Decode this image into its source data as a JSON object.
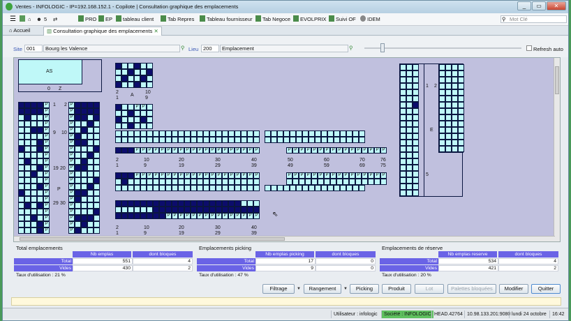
{
  "window": {
    "title": "Ventes - INFOLOGIC - IP=192.168.152.1 - Copilote | Consultation graphique des emplacements",
    "controls": [
      "_",
      "▭",
      "✕"
    ]
  },
  "toolbar": {
    "menu_count": "5",
    "items": [
      "PRO",
      "EP",
      "tableau client",
      "Tab Repres",
      "Tableau fournisseur",
      "Tab Negoce",
      "EVOLPRIX",
      "Suivi OF",
      "IDEM"
    ],
    "search_placeholder": "Mot Clé"
  },
  "tabs": {
    "home": "Accueil",
    "active": "Consultation graphique des emplacements",
    "close": "✕"
  },
  "filters": {
    "site_label": "Site",
    "site_code": "001",
    "site_name": "Bourg les Valence",
    "lieu_label": "Lieu",
    "lieu_code": "200",
    "lieu_name": "Emplacement",
    "refresh_label": "Refresh auto",
    "slider_percent": 10
  },
  "map": {
    "zone_as": "AS",
    "zone_as_0": "0",
    "zone_as_z": "Z",
    "zone_a": "A",
    "zone_a_2": "2",
    "zone_a_1": "1",
    "zone_a_10": "10",
    "zone_a_9": "9",
    "left_labels": [
      "1",
      "2",
      "9",
      "10",
      "19",
      "20",
      "P",
      "29",
      "30"
    ],
    "row_top": [
      "2",
      "1",
      "10",
      "9",
      "20",
      "19",
      "30",
      "29",
      "40",
      "39",
      "50",
      "49",
      "60",
      "59",
      "70",
      "69",
      "76",
      "75"
    ],
    "row_bottom": [
      "2",
      "1",
      "10",
      "9",
      "20",
      "19",
      "30",
      "29",
      "40",
      "39"
    ],
    "right_labels": [
      "1",
      "2",
      "E",
      "5"
    ]
  },
  "summary": [
    {
      "title": "Total emplacements",
      "col1": "Nb emplas",
      "col2": "dont bloques",
      "rows": [
        {
          "label": "Total",
          "v1": "551",
          "v2": "4"
        },
        {
          "label": "Vides",
          "v1": "430",
          "v2": "2"
        }
      ],
      "taux": "Taux d'utilisation : 21 %"
    },
    {
      "title": "Emplacements picking",
      "col1": "Nb emplas picking",
      "col2": "dont bloques",
      "rows": [
        {
          "label": "Total",
          "v1": "17",
          "v2": "0"
        },
        {
          "label": "Vides",
          "v1": "9",
          "v2": "0"
        }
      ],
      "taux": "Taux d'utilisation : 47 %"
    },
    {
      "title": "Emplacements de réserve",
      "col1": "Nb emplas reserve",
      "col2": "dont bloques",
      "rows": [
        {
          "label": "Total",
          "v1": "534",
          "v2": "4"
        },
        {
          "label": "Vides",
          "v1": "421",
          "v2": "2"
        }
      ],
      "taux": "Taux d'utilisation : 20 %"
    }
  ],
  "buttons": {
    "filtrage": "Filtrage",
    "rangement": "Rangement",
    "picking": "Picking",
    "produit": "Produit",
    "lot": "Lot",
    "palettes": "Palettes bloquées",
    "modifier": "Modifier",
    "quitter": "Quitter"
  },
  "status": {
    "user": "Utilisateur : infologic",
    "societe": "Société : INFOLOGIC",
    "head": "HEAD.42764",
    "ip": "10.98.133.201:9080",
    "date": "lundi 24 octobre",
    "time": "16:42"
  },
  "colors": {
    "accent": "#6a63e6",
    "cell_empty": "#bff8f8",
    "cell_full": "#0c0c6c",
    "map_bg": "#c0c0de"
  }
}
